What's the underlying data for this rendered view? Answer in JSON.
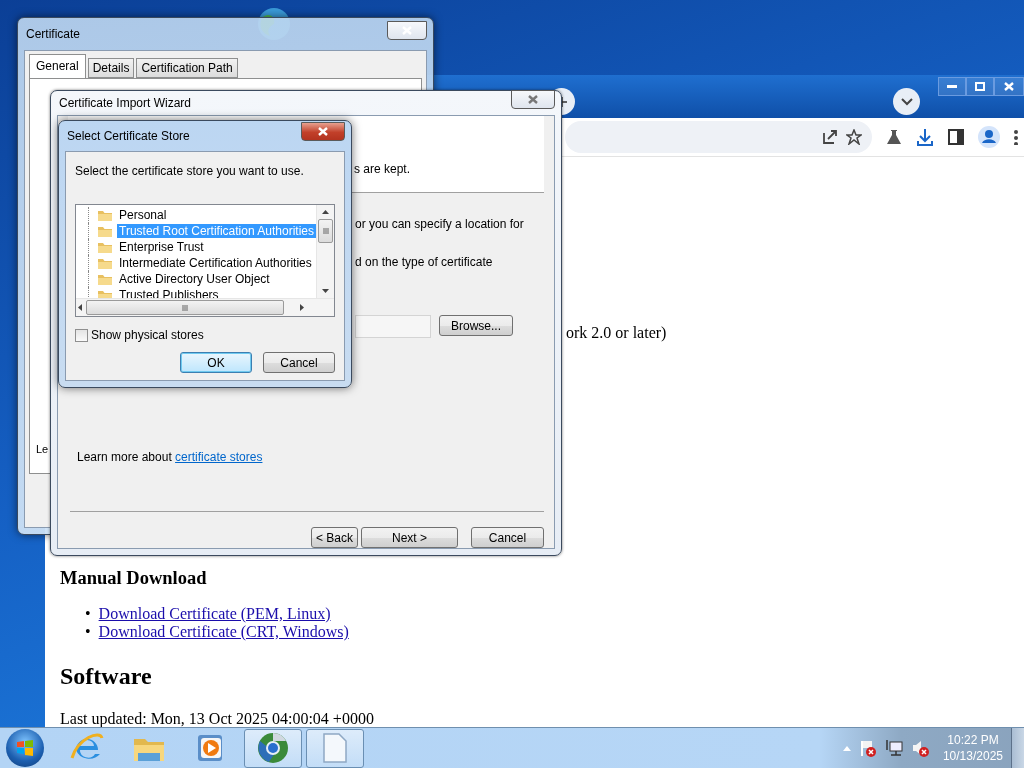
{
  "browser": {
    "page": {
      "fragment": "ork 2.0 or later)",
      "manual_download": {
        "heading": "Manual Download",
        "links": [
          {
            "marker": "•",
            "label": "Download Certificate (PEM, Linux)"
          },
          {
            "marker": "•",
            "label": "Download Certificate (CRT, Windows)"
          }
        ]
      },
      "software_heading": "Software",
      "last_updated": "Last updated: Mon, 13 Oct 2025 04:00:04 +0000"
    }
  },
  "certificate_window": {
    "title": "Certificate",
    "tabs": [
      {
        "label": "General",
        "selected": true
      },
      {
        "label": "Details",
        "selected": false
      },
      {
        "label": "Certification Path",
        "selected": false
      }
    ],
    "panel_text": "Le"
  },
  "import_wizard": {
    "title": "Certificate Import Wizard",
    "header_text": "s are kept.",
    "body_lines": [
      "or you can specify a location for",
      "d on the type of certificate"
    ],
    "browse_button": "Browse...",
    "learn_more": "Learn more about",
    "learn_more_link": "certificate stores",
    "buttons": [
      "< Back",
      "Next >",
      "Cancel"
    ]
  },
  "select_store_dialog": {
    "title": "Select Certificate Store",
    "prompt": "Select the certificate store you want to use.",
    "stores": [
      {
        "name": "Personal",
        "selected": false
      },
      {
        "name": "Trusted Root Certification Authorities",
        "selected": true
      },
      {
        "name": "Enterprise Trust",
        "selected": false
      },
      {
        "name": "Intermediate Certification Authorities",
        "selected": false
      },
      {
        "name": "Active Directory User Object",
        "selected": false
      },
      {
        "name": "Trusted Publishers",
        "selected": false
      }
    ],
    "show_physical_stores": {
      "label": "Show physical stores",
      "checked": false
    },
    "buttons": [
      {
        "label": "OK",
        "default": true
      },
      {
        "label": "Cancel",
        "default": false
      }
    ]
  },
  "taskbar": {
    "apps": [
      {
        "kind": "web-e",
        "active": false
      },
      {
        "kind": "folders",
        "active": false
      },
      {
        "kind": "player",
        "active": false
      },
      {
        "kind": "browser",
        "active": true
      },
      {
        "kind": "document",
        "active": true
      }
    ],
    "tray": {
      "time": "10:22 PM",
      "date": "10/13/2025"
    }
  }
}
